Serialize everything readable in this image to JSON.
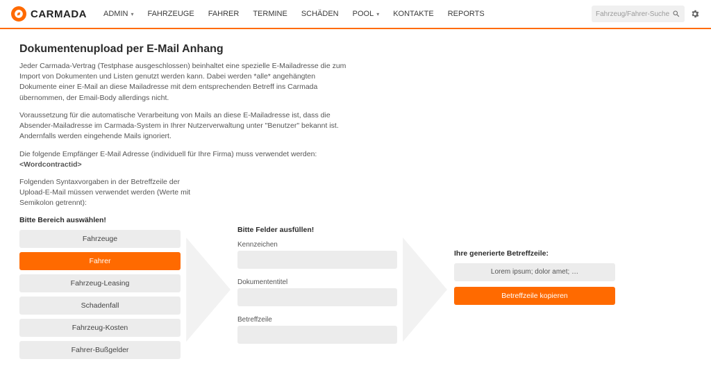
{
  "brand": "CARMADA",
  "nav": {
    "admin": "ADMIN",
    "fahrzeuge": "FAHRZEUGE",
    "fahrer": "FAHRER",
    "termine": "TERMINE",
    "schaeden": "SCHÄDEN",
    "pool": "POOL",
    "kontakte": "KONTAKTE",
    "reports": "REPORTS"
  },
  "search_placeholder": "Fahrzeug/Fahrer-Suche",
  "page": {
    "title": "Dokumentenupload per E-Mail Anhang",
    "p1": "Jeder Carmada-Vertrag (Testphase ausgeschlossen) beinhaltet eine spezielle E-Mailadresse die zum Import von Dokumenten und Listen genutzt werden kann. Dabei werden *alle* angehängten Dokumente einer E-Mail an diese Mailadresse mit dem entsprechenden Betreff ins Carmada übernommen, der Email-Body allerdings nicht.",
    "p2": "Voraussetzung für die automatische Verarbeitung von Mails an diese E-Mailadresse ist, dass die Absender-Mailadresse im Carmada-System in Ihrer Nutzerverwaltung unter \"Benutzer\" bekannt ist. Andernfalls werden eingehende Mails ignoriert.",
    "p3_prefix": "Die folgende Empfänger E-Mail Adresse (individuell für Ihre Firma) muss verwendet werden: ",
    "p3_bold": "<Wordcontractid>",
    "p4": "Folgenden Syntaxvorgaben in der Betreffzeile der Upload-E-Mail müssen verwendet werden (Werte mit Semikolon getrennt):"
  },
  "step1": {
    "header": "Bitte Bereich auswählen!",
    "options": {
      "fahrzeuge": "Fahrzeuge",
      "fahrer": "Fahrer",
      "leasing": "Fahrzeug-Leasing",
      "schadenfall": "Schadenfall",
      "kosten": "Fahrzeug-Kosten",
      "bussgelder": "Fahrer-Bußgelder"
    },
    "active": "fahrer"
  },
  "step2": {
    "header": "Bitte Felder ausfüllen!",
    "fields": {
      "kennzeichen": "Kennzeichen",
      "dokumententitel": "Dokumententitel",
      "betreffzeile": "Betreffzeile"
    }
  },
  "step3": {
    "header": "Ihre generierte Betreffzeile:",
    "generated": "Lorem ipsum; dolor amet; …",
    "copy": "Betreffzeile kopieren"
  }
}
